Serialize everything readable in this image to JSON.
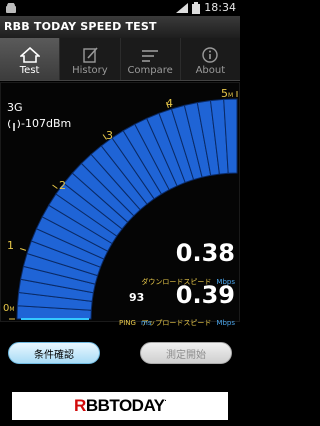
{
  "status_bar": {
    "time": "18:34"
  },
  "app": {
    "title": "RBB TODAY SPEED TEST"
  },
  "tabs": [
    {
      "label": "Test",
      "icon": "home-icon",
      "active": true
    },
    {
      "label": "History",
      "icon": "edit-note-icon",
      "active": false
    },
    {
      "label": "Compare",
      "icon": "list-lines-icon",
      "active": false
    },
    {
      "label": "About",
      "icon": "info-icon",
      "active": false
    }
  ],
  "network": {
    "type": "3G",
    "signal": "-107dBm"
  },
  "gauge": {
    "labels": [
      "0",
      "1",
      "2",
      "3",
      "4",
      "5"
    ],
    "min_unit": "M",
    "max_unit": "M",
    "value_mbps": 0.38,
    "max_mbps": 5,
    "fill_color": "#1f64d6"
  },
  "results": {
    "download": {
      "value": "0.38",
      "label": "ダウンロードスピード",
      "unit": "Mbps"
    },
    "upload": {
      "value": "0.39",
      "label": "アップロードスピード",
      "unit": "Mbps"
    },
    "ping": {
      "value": "93",
      "label": "PING",
      "unit": "ms"
    }
  },
  "buttons": {
    "conditions": "条件確認",
    "start": "測定開始"
  },
  "banner": {
    "brand": "RBBTODAY"
  }
}
